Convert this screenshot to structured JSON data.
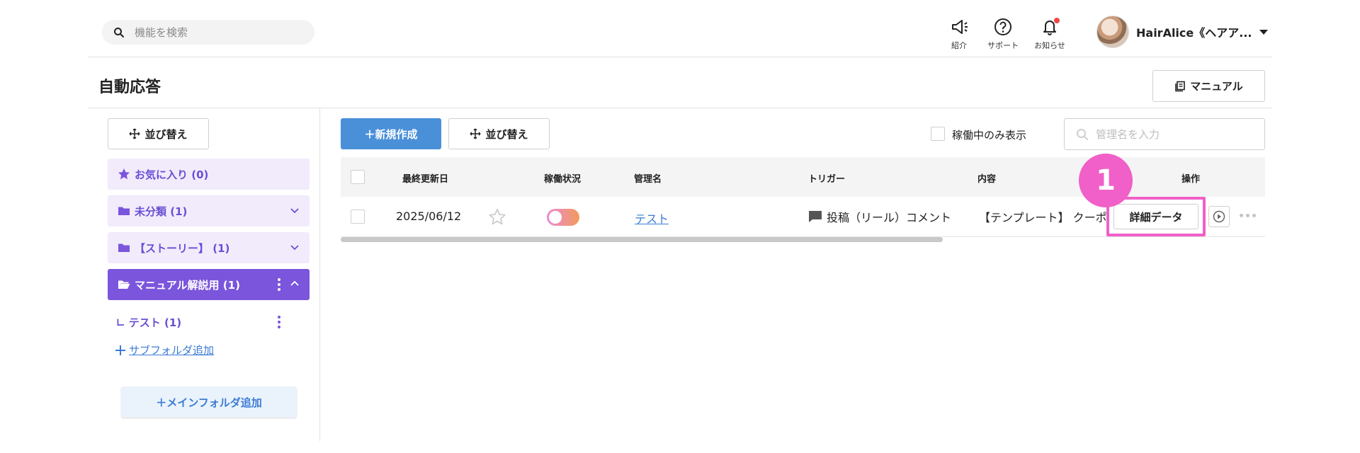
{
  "header": {
    "search_placeholder": "機能を検索",
    "icons": [
      {
        "name": "megaphone-icon",
        "label": "紹介"
      },
      {
        "name": "help-icon",
        "label": "サポート"
      },
      {
        "name": "bell-icon",
        "label": "お知らせ"
      }
    ],
    "user_name": "HairAlice《ヘアア..."
  },
  "page": {
    "title": "自動応答",
    "manual_button": "マニュアル"
  },
  "sidebar": {
    "sort_button": "並び替え",
    "folders": [
      {
        "label": "お気に入り (0)"
      },
      {
        "label": "未分類 (1)"
      },
      {
        "label": "【ストーリー】 (1)"
      },
      {
        "label": "マニュアル解説用 (1)"
      }
    ],
    "subfolder": "∟ テスト (1)",
    "add_subfolder": "サブフォルダ追加",
    "add_main_folder": "＋メインフォルダ追加"
  },
  "toolbar": {
    "new_button": "＋新規作成",
    "sort_button": "並び替え",
    "active_only_label": "稼働中のみ表示",
    "name_filter_placeholder": "管理名を入力"
  },
  "table": {
    "headers": [
      "最終更新日",
      "稼働状況",
      "管理名",
      "トリガー",
      "内容",
      "操作"
    ],
    "rows": [
      {
        "updated": "2025/06/12",
        "name": "テスト",
        "trigger": "投稿（リール）コメント",
        "content": "【テンプレート】 クーポ",
        "detail_button": "詳細データ"
      }
    ]
  },
  "callout": {
    "number": "1",
    "color": "#f060c8"
  },
  "colors": {
    "accent_purple": "#7b55dc",
    "primary_blue": "#4a90d9",
    "highlight_pink": "#f060c8"
  }
}
